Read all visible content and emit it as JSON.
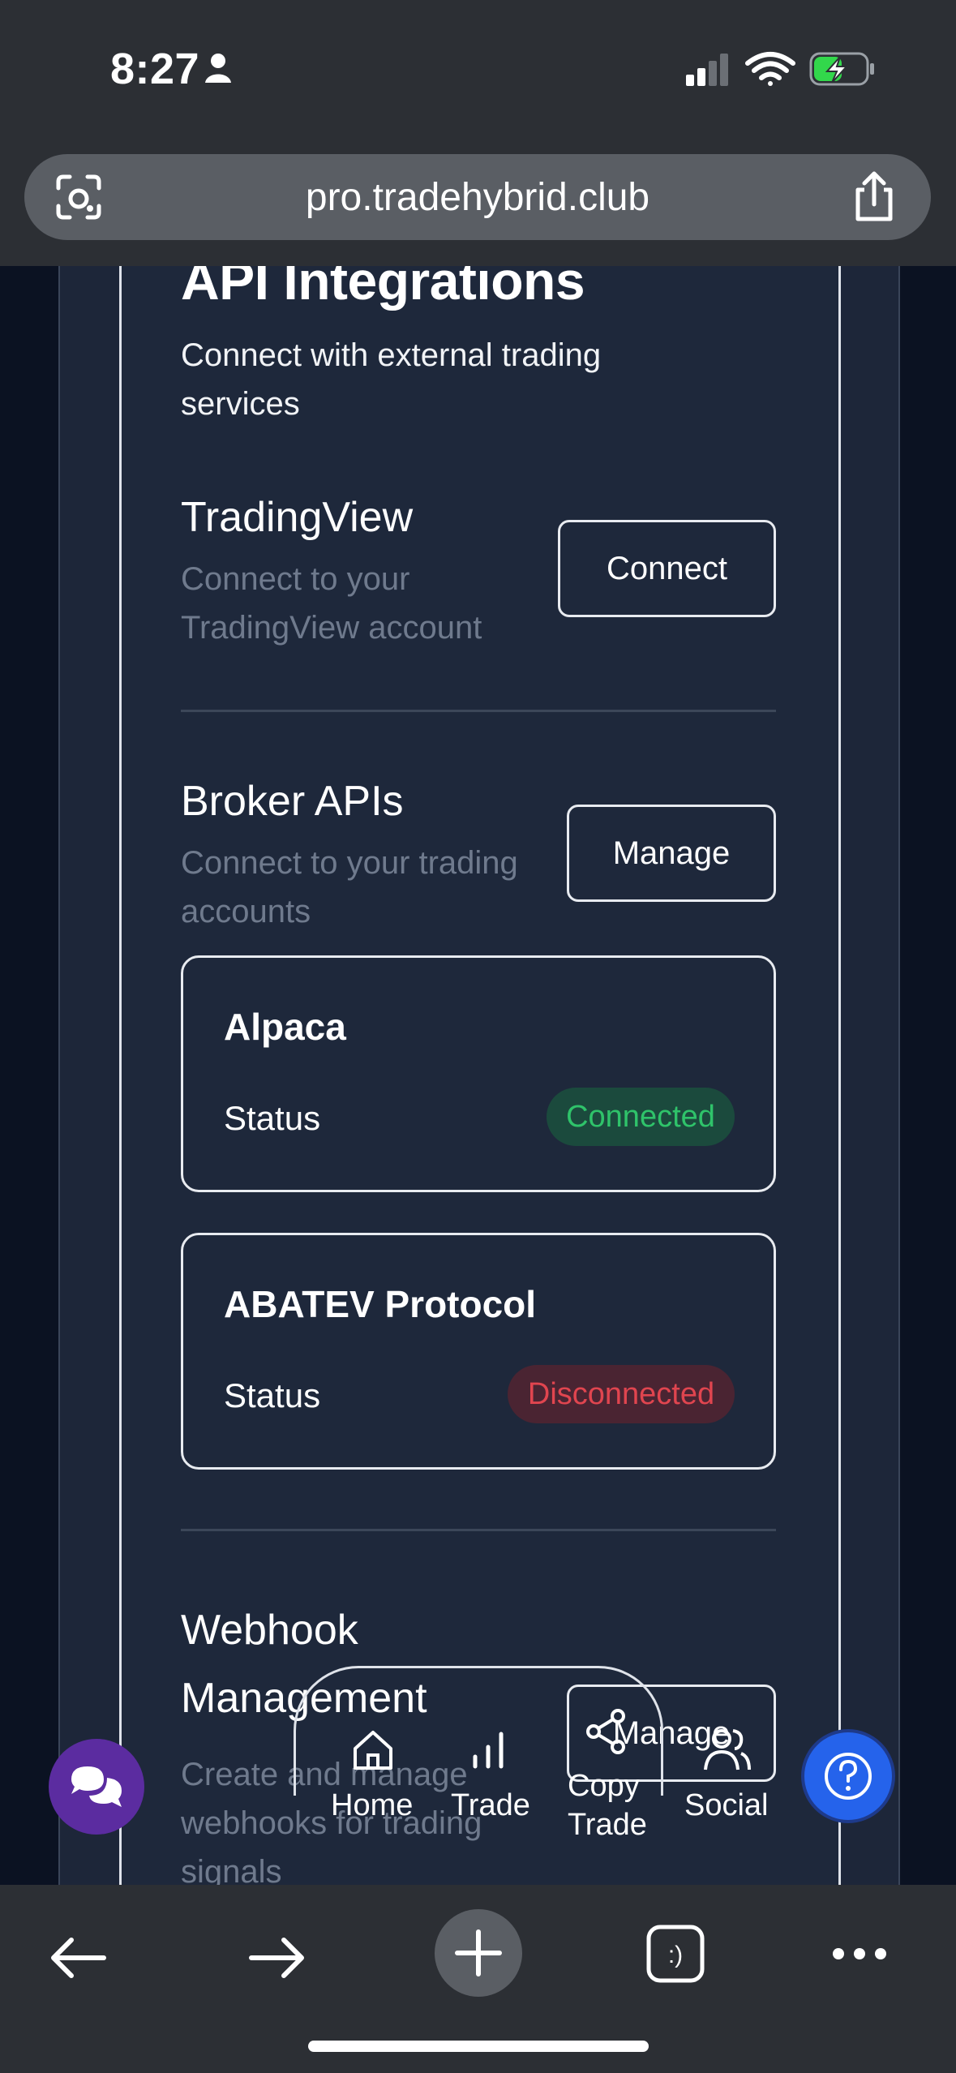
{
  "status_bar": {
    "time": "8:27",
    "battery_state": "charging"
  },
  "browser": {
    "url": "pro.tradehybrid.club"
  },
  "page": {
    "section_title": "API Integrations",
    "section_subtitle": "Connect with external trading services",
    "tradingview": {
      "title": "TradingView",
      "description": "Connect to your TradingView account",
      "button": "Connect"
    },
    "broker_apis": {
      "title": "Broker APIs",
      "description": "Connect to your trading accounts",
      "button": "Manage",
      "brokers": [
        {
          "name": "Alpaca",
          "status_label": "Status",
          "status": "Connected"
        },
        {
          "name": "ABATEV Protocol",
          "status_label": "Status",
          "status": "Disconnected"
        }
      ]
    },
    "webhook": {
      "title": "Webhook Management",
      "description": "Create and manage webhooks for trading signals",
      "button": "Manage"
    }
  },
  "bottom_nav": {
    "items": [
      {
        "label": "Home",
        "icon": "home-icon"
      },
      {
        "label": "Trade",
        "icon": "bar-chart-icon"
      },
      {
        "label": "Copy Trade",
        "icon": "share-nodes-icon"
      },
      {
        "label": "Social",
        "icon": "users-icon"
      }
    ]
  },
  "fabs": {
    "chat_icon": "chat-bubbles-icon",
    "help_icon": "help-icon"
  },
  "colors": {
    "connected": "#2fc36a",
    "disconnected": "#e0454f",
    "chat_fab": "#5b2ca0",
    "help_fab": "#2563eb"
  }
}
